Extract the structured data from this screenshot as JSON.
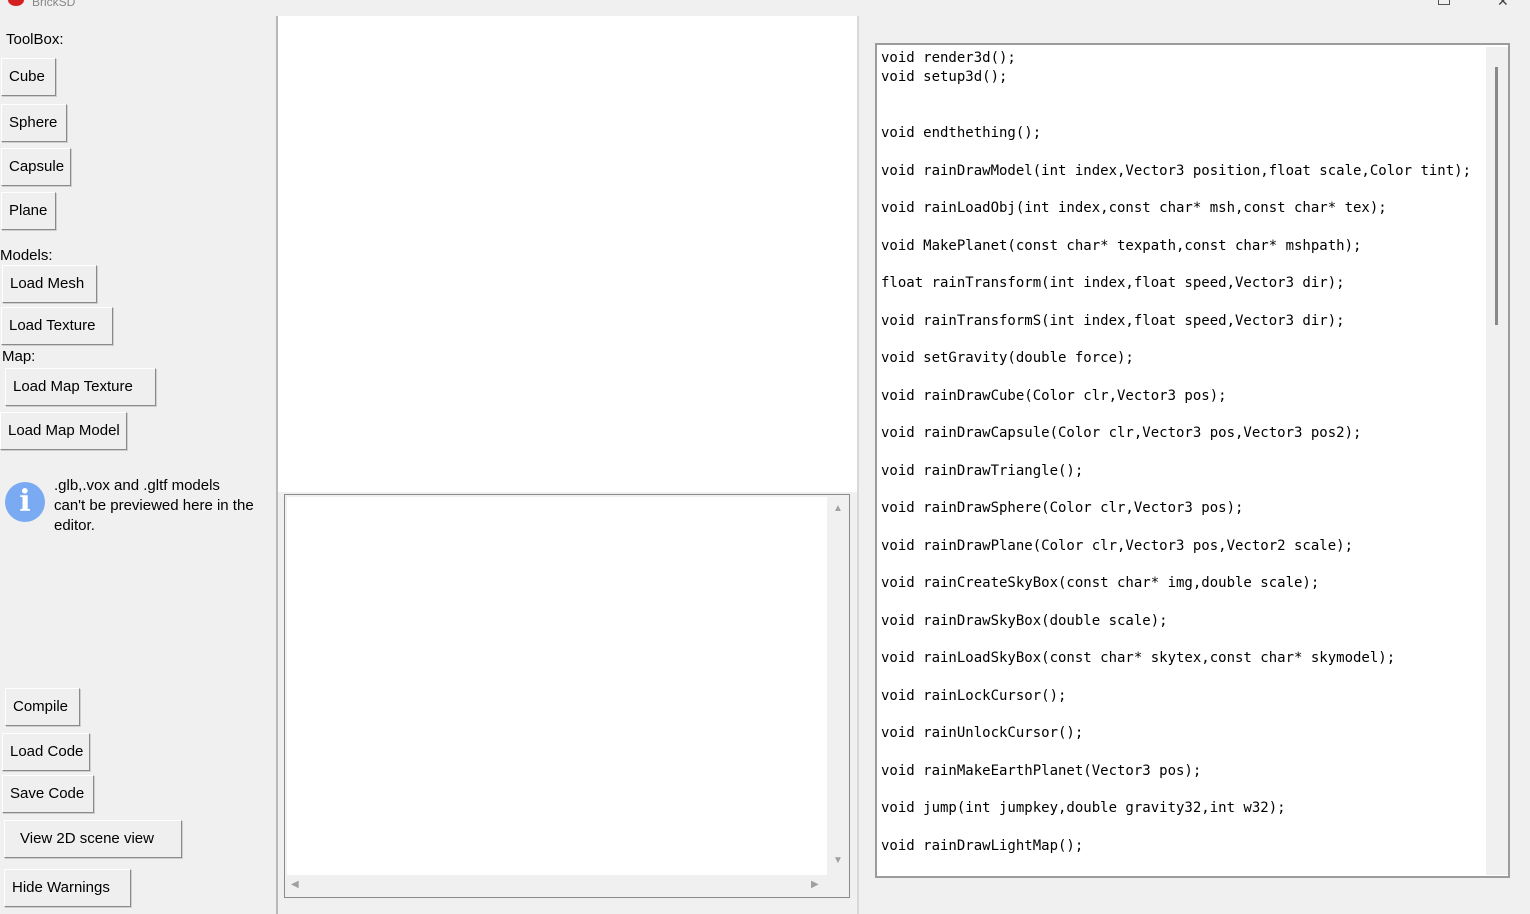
{
  "window": {
    "title": "BrickSD"
  },
  "toolbox": {
    "label": "ToolBox:",
    "cube": "Cube",
    "sphere": "Sphere",
    "capsule": "Capsule",
    "plane": "Plane"
  },
  "models": {
    "label": "Models:",
    "load_mesh": "Load Mesh",
    "load_texture": "Load Texture"
  },
  "map": {
    "label": "Map:",
    "load_map_texture": "Load Map Texture",
    "load_map_model": "Load Map Model"
  },
  "info": {
    "icon": "info-icon",
    "text": ".glb,.vox and .gltf models can't be previewed here in the editor."
  },
  "actions": {
    "compile": "Compile",
    "load_code": "Load Code",
    "save_code": "Save Code",
    "view_2d": "View 2D scene view",
    "hide_warnings": "Hide Warnings"
  },
  "code_editor": {
    "content": "void render3d();\nvoid setup3d();\n\n\nvoid endthething();\n\nvoid rainDrawModel(int index,Vector3 position,float scale,Color tint);\n\nvoid rainLoadObj(int index,const char* msh,const char* tex);\n\nvoid MakePlanet(const char* texpath,const char* mshpath);\n\nfloat rainTransform(int index,float speed,Vector3 dir);\n\nvoid rainTransformS(int index,float speed,Vector3 dir);\n\nvoid setGravity(double force);\n\nvoid rainDrawCube(Color clr,Vector3 pos);\n\nvoid rainDrawCapsule(Color clr,Vector3 pos,Vector3 pos2);\n\nvoid rainDrawTriangle();\n\nvoid rainDrawSphere(Color clr,Vector3 pos);\n\nvoid rainDrawPlane(Color clr,Vector3 pos,Vector2 scale);\n\nvoid rainCreateSkyBox(const char* img,double scale);\n\nvoid rainDrawSkyBox(double scale);\n\nvoid rainLoadSkyBox(const char* skytex,const char* skymodel);\n\nvoid rainLockCursor();\n\nvoid rainUnlockCursor();\n\nvoid rainMakeEarthPlanet(Vector3 pos);\n\nvoid jump(int jumpkey,double gravity32,int w32);\n\nvoid rainDrawLightMap();"
  }
}
